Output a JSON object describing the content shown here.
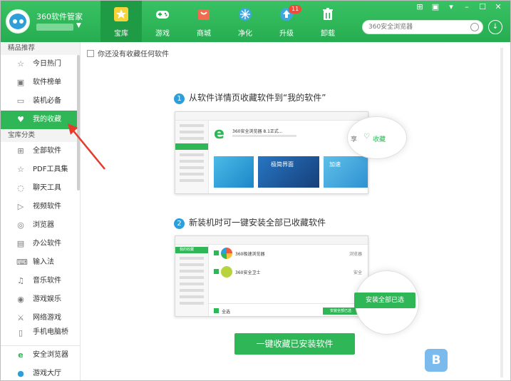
{
  "app": {
    "title": "360软件管家"
  },
  "nav": {
    "items": [
      {
        "label": "宝库",
        "icon": "star-icon",
        "active": true
      },
      {
        "label": "游戏",
        "icon": "gamepad-icon",
        "active": false
      },
      {
        "label": "商城",
        "icon": "mall-bag-icon",
        "active": false
      },
      {
        "label": "净化",
        "icon": "purify-icon",
        "active": false
      },
      {
        "label": "升级",
        "icon": "upgrade-arrow-icon",
        "active": false,
        "badge": "11"
      },
      {
        "label": "卸载",
        "icon": "trash-icon",
        "active": false
      }
    ]
  },
  "search": {
    "placeholder": "360安全浏览器"
  },
  "sidebar": {
    "featured_header": "精品推荐",
    "featured": [
      {
        "label": "今日热门",
        "icon": "star-outline-icon"
      },
      {
        "label": "软件榜单",
        "icon": "ranking-icon"
      },
      {
        "label": "装机必备",
        "icon": "monitor-icon"
      },
      {
        "label": "我的收藏",
        "icon": "heart-icon",
        "active": true
      }
    ],
    "category_header": "宝库分类",
    "categories": [
      {
        "label": "全部软件",
        "icon": "grid-icon"
      },
      {
        "label": "PDF工具集",
        "icon": "star-outline-icon"
      },
      {
        "label": "聊天工具",
        "icon": "chat-icon"
      },
      {
        "label": "视频软件",
        "icon": "video-icon"
      },
      {
        "label": "浏览器",
        "icon": "browser-icon"
      },
      {
        "label": "办公软件",
        "icon": "office-icon"
      },
      {
        "label": "输入法",
        "icon": "keyboard-icon"
      },
      {
        "label": "音乐软件",
        "icon": "music-icon"
      },
      {
        "label": "游戏娱乐",
        "icon": "game-icon"
      },
      {
        "label": "网络游戏",
        "icon": "network-game-icon"
      },
      {
        "label": "手机电脑桥",
        "icon": "phone-icon"
      }
    ],
    "bottom": [
      {
        "label": "安全浏览器",
        "icon": "ie-browser-icon"
      },
      {
        "label": "游戏大厅",
        "icon": "game-hall-icon"
      }
    ]
  },
  "main": {
    "empty_tip": "你还没有收藏任何软件",
    "step1": {
      "num": "1",
      "text": "从软件详情页收藏软件到“我的软件”"
    },
    "step1_mock": {
      "product": "360安全浏览器 8.1正式...",
      "share": "享",
      "fav": "收藏",
      "banner": "极简界面",
      "banner2": "加速"
    },
    "step2": {
      "num": "2",
      "text": "新装机时可一键安装全部已收藏软件"
    },
    "step2_mock": {
      "side_label": "我的收藏",
      "rows": [
        {
          "name": "360极速浏览器",
          "tag": "浏览器"
        },
        {
          "name": "360安全卫士",
          "tag": "安全"
        }
      ],
      "select_all": "全选",
      "install_small": "安装全部已选",
      "install_big": "安装全部已选"
    },
    "cta": "一键收藏已安装软件"
  },
  "watermark": {
    "logo": "B"
  },
  "colors": {
    "accent": "#2fb657",
    "header": "#27ad51",
    "badge": "#f04a3a",
    "step": "#2b9edb",
    "arrow": "#e53b2c"
  }
}
